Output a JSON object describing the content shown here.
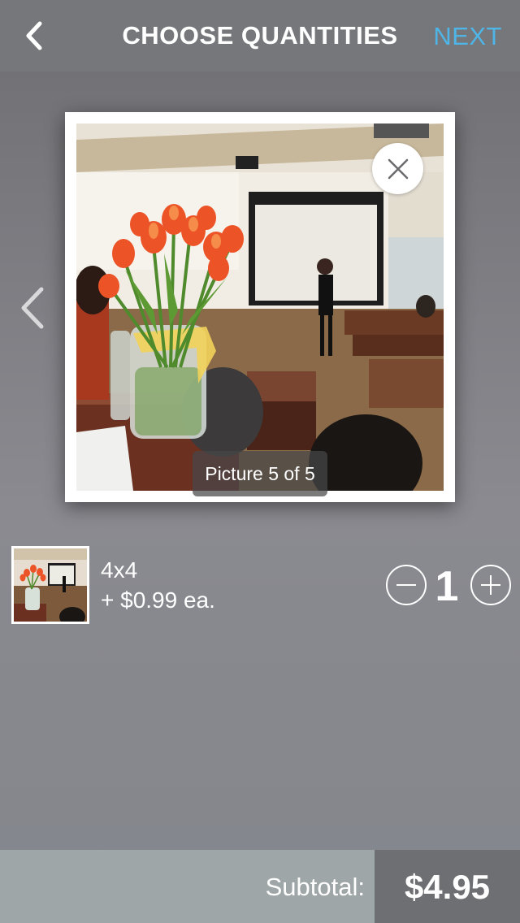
{
  "header": {
    "title": "CHOOSE QUANTITIES",
    "next_label": "NEXT"
  },
  "carousel": {
    "counter": "Picture 5 of 5"
  },
  "item": {
    "size": "4x4",
    "price": "+ $0.99 ea.",
    "quantity": "1"
  },
  "footer": {
    "subtotal_label": "Subtotal:",
    "subtotal_value": "$4.95"
  },
  "colors": {
    "accent": "#4fb5e6",
    "header_bg": "#76777b",
    "footer_label_bg": "#9fa6a8",
    "footer_value_bg": "#6e6f73"
  },
  "icons": [
    "chevron-left-icon",
    "close-icon",
    "minus-icon",
    "plus-icon"
  ]
}
